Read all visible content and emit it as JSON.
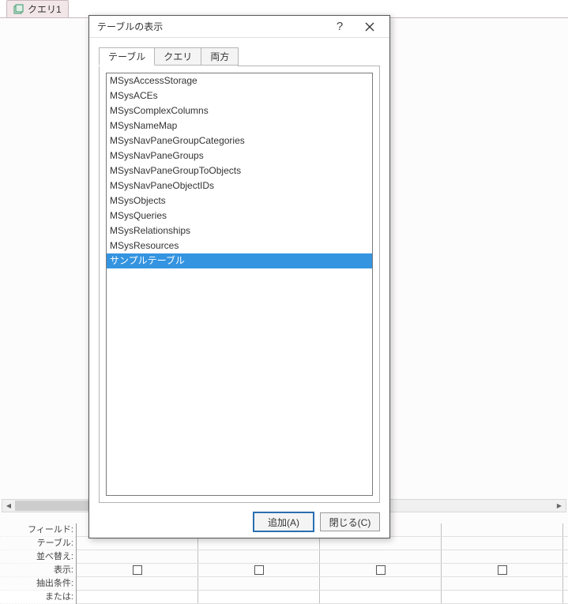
{
  "bg_tab": {
    "label": "クエリ1"
  },
  "dialog": {
    "title": "テーブルの表示",
    "tabs": [
      {
        "label": "テーブル",
        "active": true
      },
      {
        "label": "クエリ",
        "active": false
      },
      {
        "label": "両方",
        "active": false
      }
    ],
    "items": [
      {
        "label": "MSysAccessStorage",
        "selected": false
      },
      {
        "label": "MSysACEs",
        "selected": false
      },
      {
        "label": "MSysComplexColumns",
        "selected": false
      },
      {
        "label": "MSysNameMap",
        "selected": false
      },
      {
        "label": "MSysNavPaneGroupCategories",
        "selected": false
      },
      {
        "label": "MSysNavPaneGroups",
        "selected": false
      },
      {
        "label": "MSysNavPaneGroupToObjects",
        "selected": false
      },
      {
        "label": "MSysNavPaneObjectIDs",
        "selected": false
      },
      {
        "label": "MSysObjects",
        "selected": false
      },
      {
        "label": "MSysQueries",
        "selected": false
      },
      {
        "label": "MSysRelationships",
        "selected": false
      },
      {
        "label": "MSysResources",
        "selected": false
      },
      {
        "label": "サンプルテーブル",
        "selected": true
      }
    ],
    "buttons": {
      "add": "追加(A)",
      "close": "閉じる(C)"
    }
  },
  "grid": {
    "labels": {
      "field": "フィールド:",
      "table": "テーブル:",
      "sort": "並べ替え:",
      "show": "表示:",
      "criteria": "抽出条件:",
      "or": "または:"
    }
  }
}
